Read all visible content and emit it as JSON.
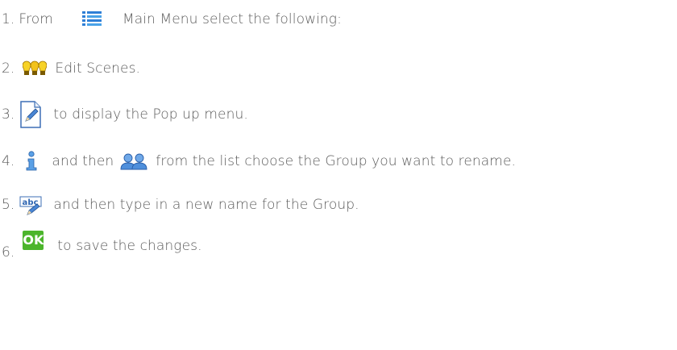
{
  "steps": [
    {
      "number": "1.",
      "before": "From",
      "icon": "main-menu-list-icon",
      "text": "Main Menu select the following:"
    },
    {
      "number": "2.",
      "icon": "edit-scenes-bulbs-icon",
      "text": "Edit Scenes."
    },
    {
      "number": "3.",
      "icon": "edit-pencil-icon",
      "text": "to display the Pop up menu."
    },
    {
      "number": "4.",
      "icon": "info-icon",
      "middle": "and then",
      "icon2": "group-users-icon",
      "text": "from the list choose the Group you want to rename."
    },
    {
      "number": "5.",
      "icon": "rename-abc-icon",
      "text": "and then type in a new name for the Group."
    },
    {
      "number": "6.",
      "icon": "ok-button-icon",
      "icon_label": "OK",
      "text": "to save the changes."
    }
  ],
  "colors": {
    "text": "#5b5b5b",
    "ok_green": "#4cb52c",
    "menu_blue": "#2f7fd6",
    "bulb_yellow": "#f2c21c",
    "info_blue": "#3a7ac8"
  }
}
